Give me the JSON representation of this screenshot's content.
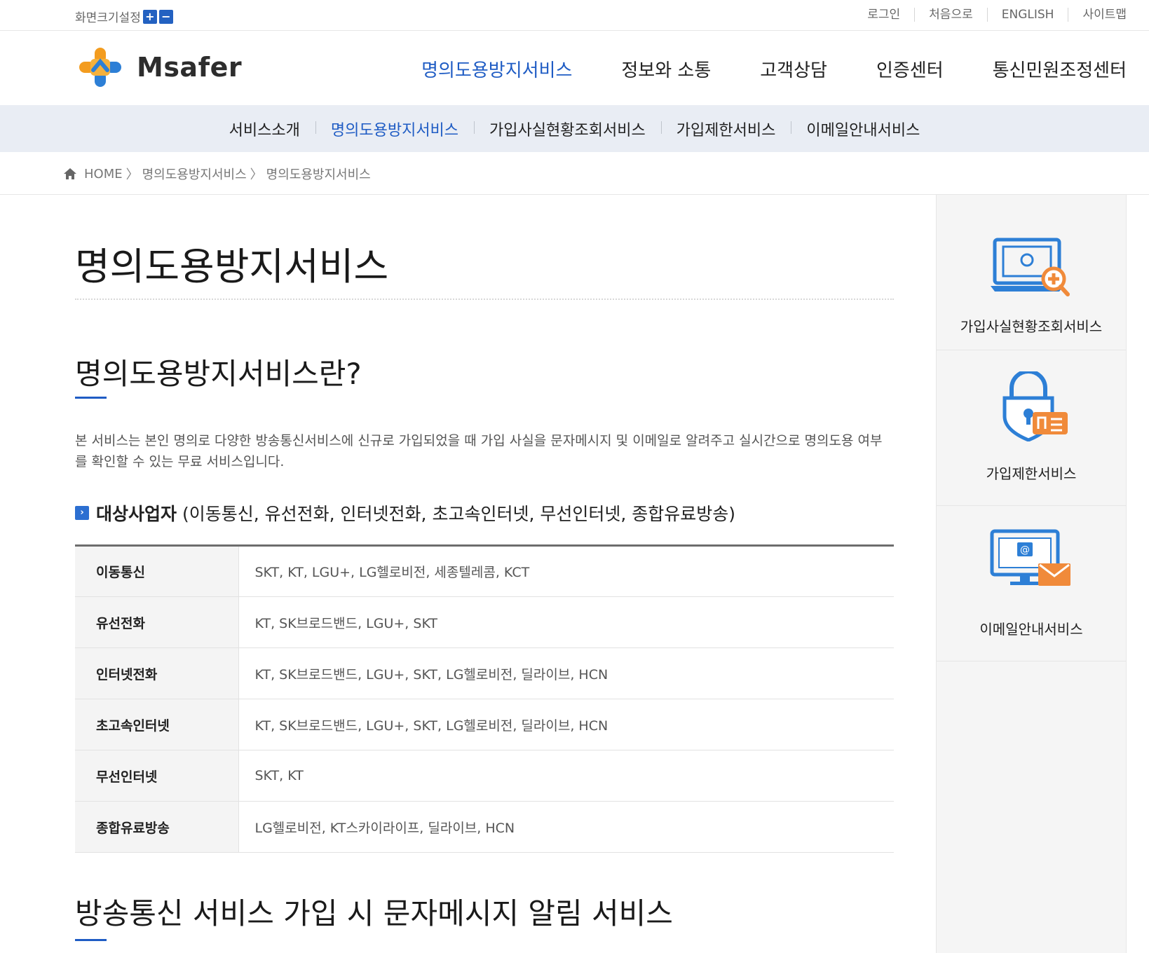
{
  "util": {
    "font_size_label": "화면크기설정",
    "plus": "+",
    "minus": "−",
    "menu": [
      "로그인",
      "처음으로",
      "ENGLISH",
      "사이트맵"
    ]
  },
  "header": {
    "logo_text": "Msafer",
    "gnb": [
      "명의도용방지서비스",
      "정보와 소통",
      "고객상담",
      "인증센터",
      "통신민원조정센터"
    ]
  },
  "subnav": [
    "서비스소개",
    "명의도용방지서비스",
    "가입사실현황조회서비스",
    "가입제한서비스",
    "이메일안내서비스"
  ],
  "breadcrumb": {
    "home": "HOME",
    "sep": "〉",
    "items": [
      "명의도용방지서비스",
      "명의도용방지서비스"
    ]
  },
  "main": {
    "page_title": "명의도용방지서비스",
    "section1_title": "명의도용방지서비스란?",
    "description": "본 서비스는 본인 명의로 다양한 방송통신서비스에 신규로 가입되었을 때 가입 사실을 문자메시지 및 이메일로 알려주고 실시간으로 명의도용 여부를 확인할 수 있는 무료 서비스입니다.",
    "target_title": "대상사업자",
    "target_sub": "(이동통신, 유선전화, 인터넷전화, 초고속인터넷, 무선인터넷, 종합유료방송)",
    "table": [
      {
        "type": "이동통신",
        "providers": "SKT, KT, LGU+, LG헬로비전, 세종텔레콤, KCT"
      },
      {
        "type": "유선전화",
        "providers": "KT, SK브로드밴드, LGU+, SKT"
      },
      {
        "type": "인터넷전화",
        "providers": "KT, SK브로드밴드, LGU+, SKT, LG헬로비전, 딜라이브, HCN"
      },
      {
        "type": "초고속인터넷",
        "providers": "KT, SK브로드밴드, LGU+, SKT, LG헬로비전, 딜라이브, HCN"
      },
      {
        "type": "무선인터넷",
        "providers": "SKT, KT"
      },
      {
        "type": "종합유료방송",
        "providers": "LG헬로비전, KT스카이라이프, 딜라이브, HCN"
      }
    ],
    "section2_title": "방송통신 서비스 가입 시 문자메시지 알림 서비스"
  },
  "quick": [
    {
      "label": "가입사실현황조회서비스",
      "icon": "monitor-search-icon"
    },
    {
      "label": "가입제한서비스",
      "icon": "lock-card-icon"
    },
    {
      "label": "이메일안내서비스",
      "icon": "monitor-mail-icon"
    }
  ],
  "colors": {
    "accent": "#1f5cc4",
    "orange": "#f08a3a",
    "subnav_bg": "#e9edf4"
  }
}
